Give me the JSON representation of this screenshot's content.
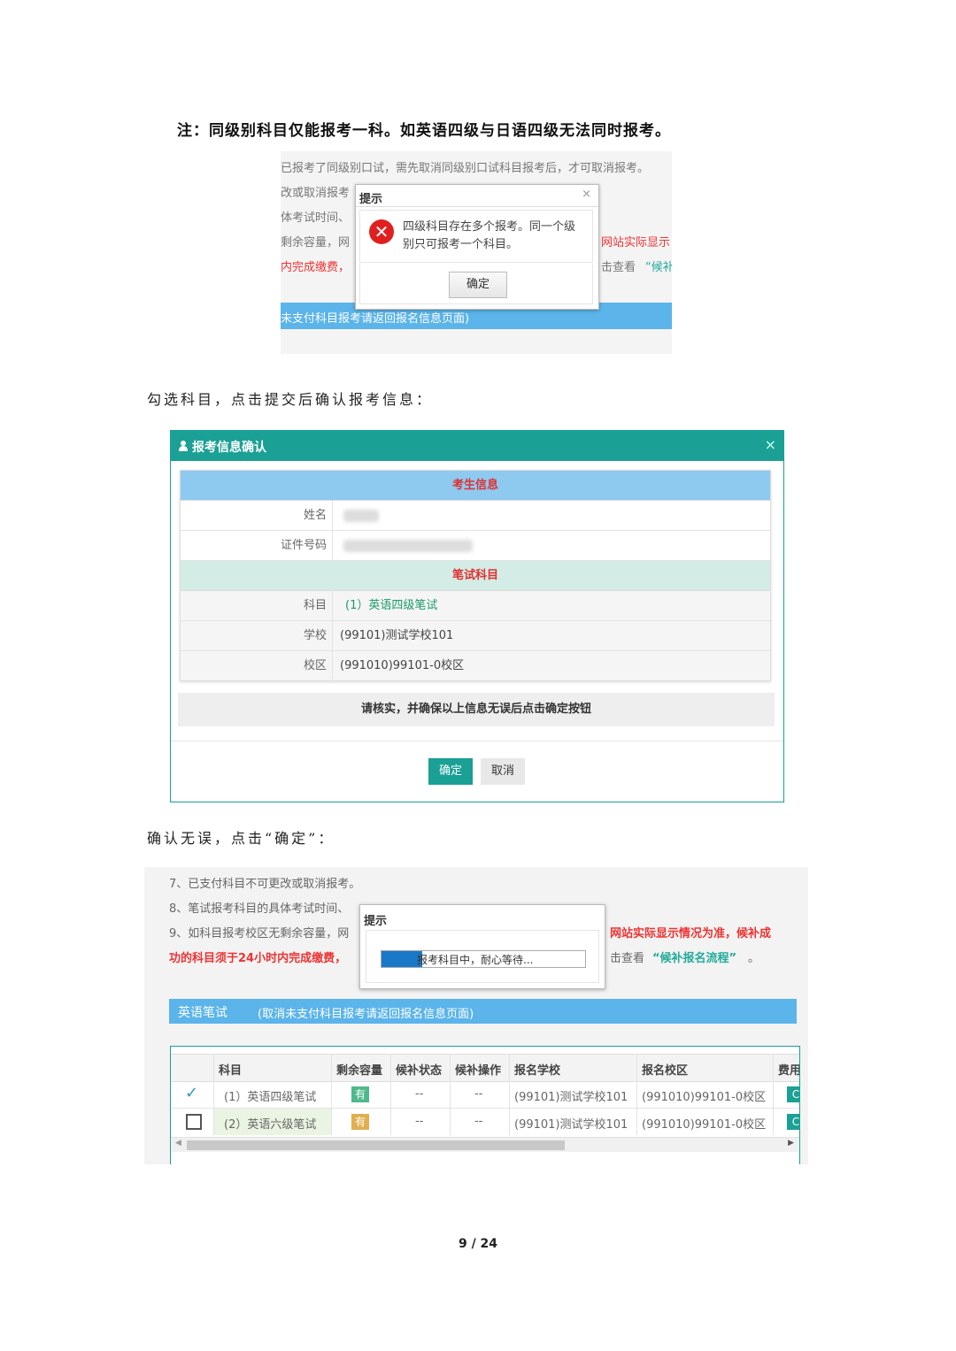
{
  "doc": {
    "note": "注：同级别科目仅能报考一科。如英语四级与日语四级无法同时报考。",
    "step1": "勾选科目，点击提交后确认报考信息：",
    "step2": "确认无误，点击“确定”：",
    "page_number": "9 / 24"
  },
  "shot1": {
    "lines": [
      "已报考了同级别口试，需先取消同级别口试科目报考后，才可取消报考。",
      "改或取消报考",
      "体考试时间、",
      "剩余容量，网",
      "内完成缴费，"
    ],
    "right_red": "网站实际显示",
    "right_link_prefix": "击查看",
    "right_link": "“候补",
    "bar_text": "未支付科目报考请返回报名信息页面)",
    "dialog": {
      "title": "提示",
      "close": "×",
      "message": "四级科目存在多个报考。同一个级别只可报考一个科目。",
      "ok": "确定"
    }
  },
  "shot2": {
    "title": "报考信息确认",
    "close": "×",
    "section_student": "考生信息",
    "name_label": "姓名",
    "id_label": "证件号码",
    "section_subject": "笔试科目",
    "subject_label": "科目",
    "subject_value": "(1）英语四级笔试",
    "school_label": "学校",
    "school_value": "(99101)测试学校101",
    "campus_label": "校区",
    "campus_value": "(991010)99101-0校区",
    "confirm_text": "请核实，并确保以上信息无误后点击确定按钮",
    "ok": "确定",
    "cancel": "取消"
  },
  "shot3": {
    "line7": "7、已支付科目不可更改或取消报考。",
    "line8": "8、笔试报考科目的具体考试时间、",
    "line9": "9、如科目报考校区无剩余容量，网",
    "line9_right_red": "网站实际显示情况为准，候补成",
    "line10_red": "功的科目须于24小时内完成缴费，",
    "line10_right_prefix": "击查看",
    "line10_right_link": "“候补报名流程”",
    "line10_dot": "。",
    "dialog": {
      "title": "提示",
      "progress_text": "报考科目中，耐心等待...",
      "progress": 0.2
    },
    "section_title": "英语笔试",
    "section_note": "(取消未支付科目报考请返回报名信息页面)",
    "headers": [
      "科目",
      "剩余容量",
      "候补状态",
      "候补操作",
      "报名学校",
      "报名校区",
      "费用"
    ],
    "rows": [
      {
        "checked": true,
        "subject": "(1）英语四级笔试",
        "capacity": "有",
        "status": "--",
        "action": "--",
        "school": "(99101)测试学校101",
        "campus": "(991010)99101-0校区",
        "fee": "C"
      },
      {
        "checked": false,
        "subject": "(2）英语六级笔试",
        "capacity": "有",
        "status": "--",
        "action": "--",
        "school": "(99101)测试学校101",
        "campus": "(991010)99101-0校区",
        "fee": "C"
      }
    ],
    "colors": {
      "badge_green": "#4fb98c",
      "badge_orange": "#e0b050",
      "accent": "#1aa095",
      "bar": "#5bb4ea"
    }
  }
}
